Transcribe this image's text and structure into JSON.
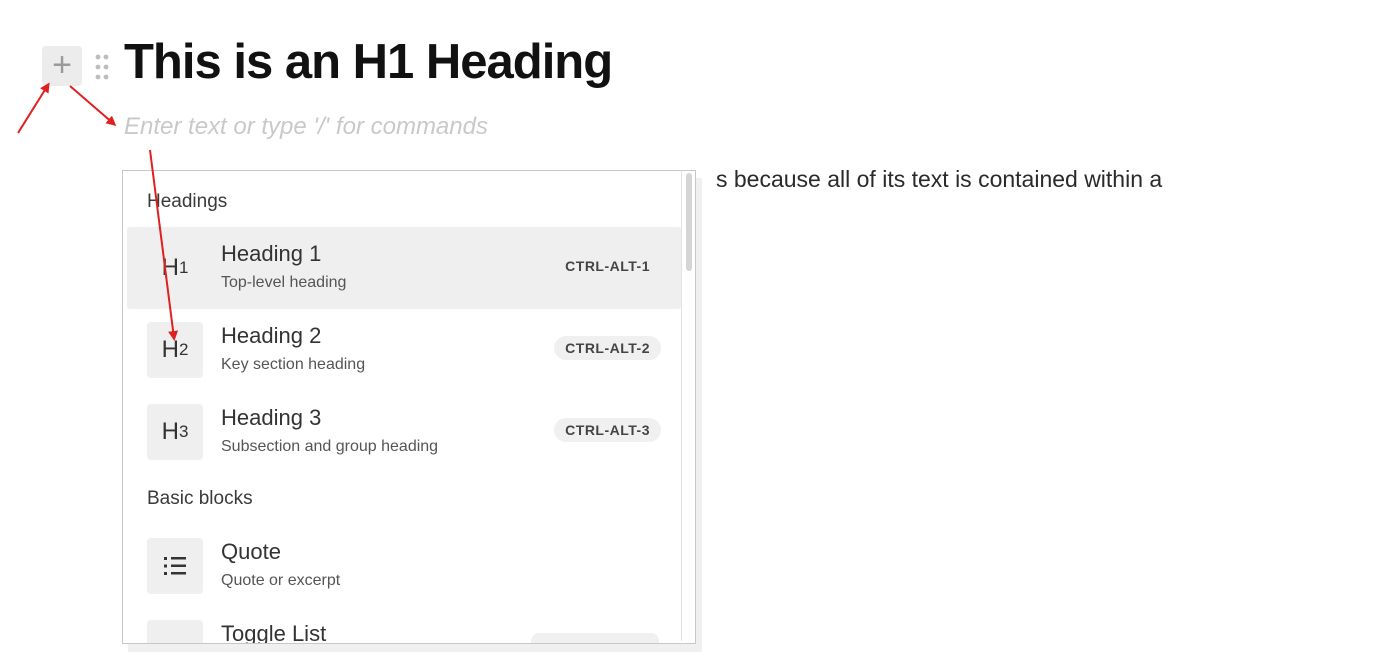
{
  "editor": {
    "heading": "This is an H1 Heading",
    "placeholder": "Enter text or type '/' for commands",
    "paragraph_tail": "s because all of its text is contained within a",
    "add_icon": "plus-icon",
    "drag_icon": "drag-handle-icon"
  },
  "menu": {
    "sections": [
      {
        "label": "Headings"
      },
      {
        "label": "Basic blocks"
      }
    ],
    "items": [
      {
        "icon_main": "H",
        "icon_sub": "1",
        "title": "Heading 1",
        "subtitle": "Top-level heading",
        "shortcut": "CTRL-ALT-1",
        "active": true
      },
      {
        "icon_main": "H",
        "icon_sub": "2",
        "title": "Heading 2",
        "subtitle": "Key section heading",
        "shortcut": "CTRL-ALT-2"
      },
      {
        "icon_main": "H",
        "icon_sub": "3",
        "title": "Heading 3",
        "subtitle": "Subsection and group heading",
        "shortcut": "CTRL-ALT-3"
      },
      {
        "icon": "quote-icon",
        "title": "Quote",
        "subtitle": "Quote or excerpt"
      },
      {
        "icon": "toggle-list-icon",
        "title": "Toggle List"
      }
    ]
  },
  "colors": {
    "annotation_arrow": "#e02020",
    "active_item_bg": "#efefef"
  }
}
